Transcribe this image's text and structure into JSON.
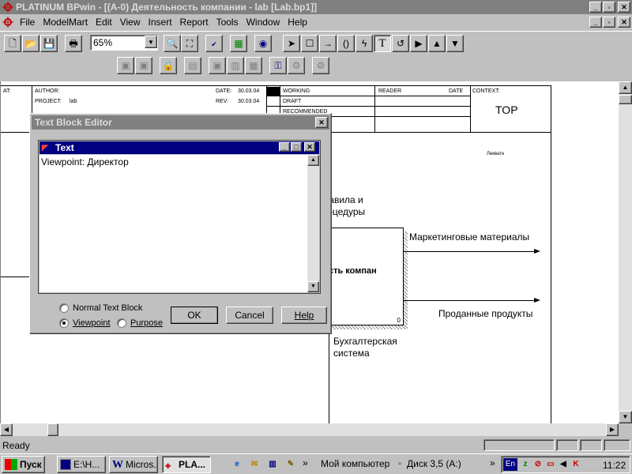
{
  "window": {
    "title": "PLATINUM BPwin - [(A-0) Деятельность компании - lab  [Lab.bp1]]"
  },
  "menu": [
    "File",
    "ModelMart",
    "Edit",
    "View",
    "Insert",
    "Report",
    "Tools",
    "Window",
    "Help"
  ],
  "toolbar": {
    "zoom": "65%"
  },
  "diagram": {
    "at_label": "AT:",
    "author_label": "AUTHOR:",
    "project_label": "PROJECT:",
    "project_value": "lab",
    "date_label": "DATE:",
    "date_value": "30.03.04",
    "rev_label": "REV:",
    "rev_value": "30.03.04",
    "working": "WORKING",
    "draft": "DRAFT",
    "recommended": "RECOMMENDED",
    "reader_label": "READER",
    "reader_date_label": "DATE",
    "context_label": "CONTEXT:",
    "context_value": "TOP",
    "small_note": "Лекватн",
    "control_arrow_label": "Правила и процедуры",
    "box_label": "Деятельность компании",
    "box_number": "0",
    "output1": "Маркетинговые материалы",
    "output2": "Проданные продукты",
    "mechanism": "Бухгалтерская система"
  },
  "dialog": {
    "title": "Text Block Editor",
    "inner_title": "Text",
    "text": "Viewpoint: Директор",
    "radio_normal": "Normal Text Block",
    "radio_viewpoint": "Viewpoint",
    "radio_purpose": "Purpose",
    "selected": "viewpoint",
    "ok": "OK",
    "cancel": "Cancel",
    "help": "Help"
  },
  "status": {
    "text": "Ready"
  },
  "taskbar": {
    "start": "Пуск",
    "tasks": [
      "E:\\H...",
      "Micros...",
      "PLA..."
    ],
    "active_task": "PLA...",
    "my_computer": "Мой компьютер",
    "disk": "Диск 3,5 (A:)",
    "lang": "En",
    "clock": "11:22"
  },
  "icons": [
    "new-icon",
    "open-icon",
    "save-icon",
    "print-icon",
    "zoom-in-icon",
    "zoom-fit-icon",
    "spell-check-icon",
    "navigator-icon",
    "model-explorer-icon",
    "pointer-icon",
    "box-icon",
    "arrow-icon",
    "squiggle-icon",
    "tunnel-icon",
    "text-icon",
    "undo-icon",
    "play-icon",
    "up-icon",
    "down-icon"
  ]
}
